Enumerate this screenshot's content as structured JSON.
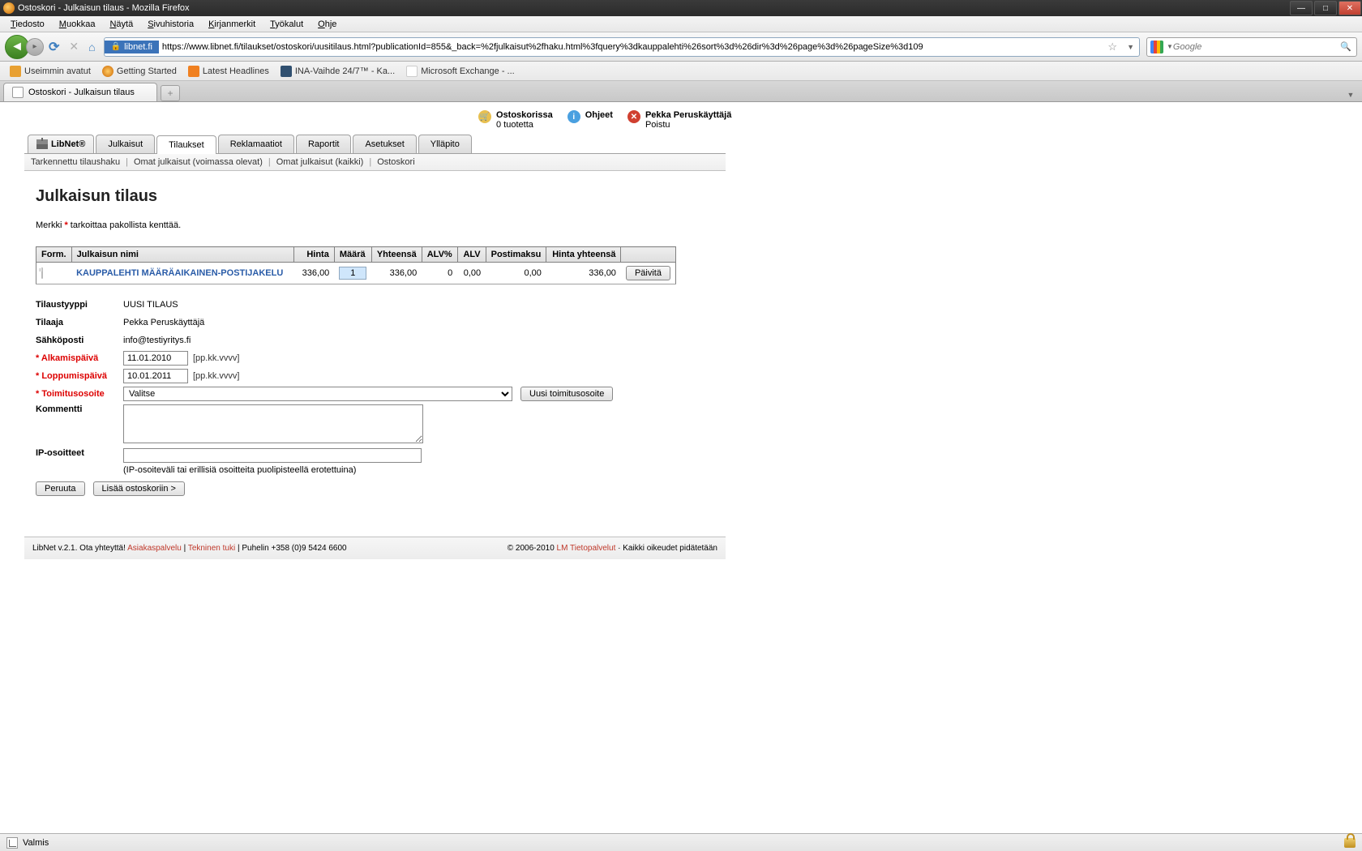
{
  "window": {
    "title": "Ostoskori - Julkaisun tilaus - Mozilla Firefox"
  },
  "menubar": [
    "Tiedosto",
    "Muokkaa",
    "Näytä",
    "Sivuhistoria",
    "Kirjanmerkit",
    "Työkalut",
    "Ohje"
  ],
  "urlbar": {
    "site_identity": "libnet.fi",
    "url": "https://www.libnet.fi/tilaukset/ostoskori/uusitilaus.html?publicationId=855&_back=%2fjulkaisut%2fhaku.html%3fquery%3dkauppalehti%26sort%3d%26dir%3d%26page%3d%26pageSize%3d109"
  },
  "searchbox": {
    "placeholder": "Google"
  },
  "bookmarks": [
    "Useimmin avatut",
    "Getting Started",
    "Latest Headlines",
    "INA-Vaihde 24/7™ - Ka...",
    "Microsoft Exchange - ..."
  ],
  "tab": {
    "title": "Ostoskori - Julkaisun tilaus"
  },
  "userbar": {
    "cart_label": "Ostoskorissa",
    "cart_count": "0 tuotetta",
    "help": "Ohjeet",
    "user_name": "Pekka Peruskäyttäjä",
    "logout": "Poistu"
  },
  "brand": "LibNet®",
  "main_tabs": [
    "Julkaisut",
    "Tilaukset",
    "Reklamaatiot",
    "Raportit",
    "Asetukset",
    "Ylläpito"
  ],
  "subnav": [
    "Tarkennettu tilaushaku",
    "Omat julkaisut (voimassa olevat)",
    "Omat julkaisut (kaikki)",
    "Ostoskori"
  ],
  "page_title": "Julkaisun tilaus",
  "required_note_prefix": "Merkki ",
  "required_note_suffix": " tarkoittaa pakollista kenttää.",
  "table": {
    "headers": {
      "form": "Form.",
      "name": "Julkaisun nimi",
      "price": "Hinta",
      "qty": "Määrä",
      "subtotal": "Yhteensä",
      "vatp": "ALV%",
      "vat": "ALV",
      "post": "Postimaksu",
      "total": "Hinta yhteensä"
    },
    "row": {
      "name": "KAUPPALEHTI MÄÄRÄAIKAINEN-POSTIJAKELU",
      "price": "336,00",
      "qty": "1",
      "subtotal": "336,00",
      "vatp": "0",
      "vat": "0,00",
      "post": "0,00",
      "total": "336,00"
    },
    "update_btn": "Päivitä"
  },
  "form": {
    "type_label": "Tilaustyyppi",
    "type_value": "UUSI TILAUS",
    "orderer_label": "Tilaaja",
    "orderer_value": "Pekka Peruskäyttäjä",
    "email_label": "Sähköposti",
    "email_value": "info@testiyritys.fi",
    "start_label": "* Alkamispäivä",
    "start_value": "11.01.2010",
    "date_hint": "[pp.kk.vvvv]",
    "end_label": "* Loppumispäivä",
    "end_value": "10.01.2011",
    "addr_label": "* Toimitusosoite",
    "addr_selected": "Valitse",
    "addr_new_btn": "Uusi toimitusosoite",
    "comment_label": "Kommentti",
    "ip_label": "IP-osoitteet",
    "ip_hint": "(IP-osoiteväli tai erillisiä osoitteita puolipisteellä erotettuina)",
    "cancel_btn": "Peruuta",
    "add_btn": "Lisää ostoskoriin >"
  },
  "footer": {
    "left_prefix": "LibNet v.2.1. Ota yhteyttä! ",
    "link1": "Asiakaspalvelu",
    "sep": " | ",
    "link2": "Tekninen tuki",
    "phone": " | Puhelin +358 (0)9 5424 6600",
    "right_prefix": "© 2006-2010 ",
    "right_link": "LM Tietopalvelut",
    "right_suffix": " · Kaikki oikeudet pidätetään"
  },
  "statusbar": {
    "text": "Valmis"
  }
}
